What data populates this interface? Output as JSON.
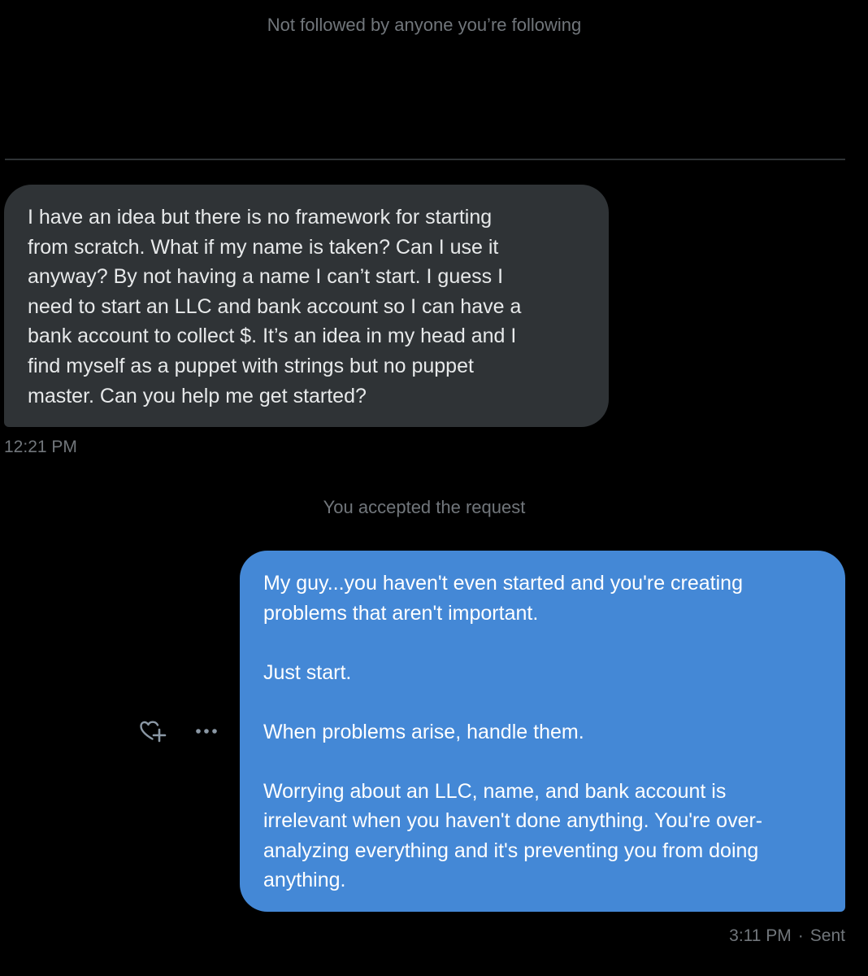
{
  "notices": {
    "top": "Not followed by anyone you’re following",
    "accepted": "You accepted the request"
  },
  "messages": {
    "incoming": {
      "text": "I have an idea but there is no framework for starting\nfrom scratch. What if my name is taken? Can I use it\nanyway? By not having a name I can’t start. I guess I\nneed to start an LLC and bank account so I can have a\nbank account to collect $.  It’s an idea in my head and I\nfind myself as a puppet with strings but no puppet\nmaster. Can you help me get started?",
      "time": "12:21 PM"
    },
    "outgoing": {
      "text": "My guy...you haven't even started and you're creating\nproblems that aren't important.\n\nJust start.\n\nWhen problems arise, handle them.\n\nWorrying about an LLC, name, and bank account is\nirrelevant when you haven't done anything. You're over-\nanalyzing everything and it's preventing you from doing\nanything.",
      "time": "3:11 PM",
      "separator": "·",
      "status": "Sent"
    }
  },
  "actions": {
    "react_icon": "heart-plus-icon",
    "more_icon": "more-horizontal-icon"
  },
  "colors": {
    "background": "#000000",
    "incoming_bubble": "#2f3336",
    "outgoing_bubble": "#4488d6",
    "muted_text": "#71767b"
  }
}
